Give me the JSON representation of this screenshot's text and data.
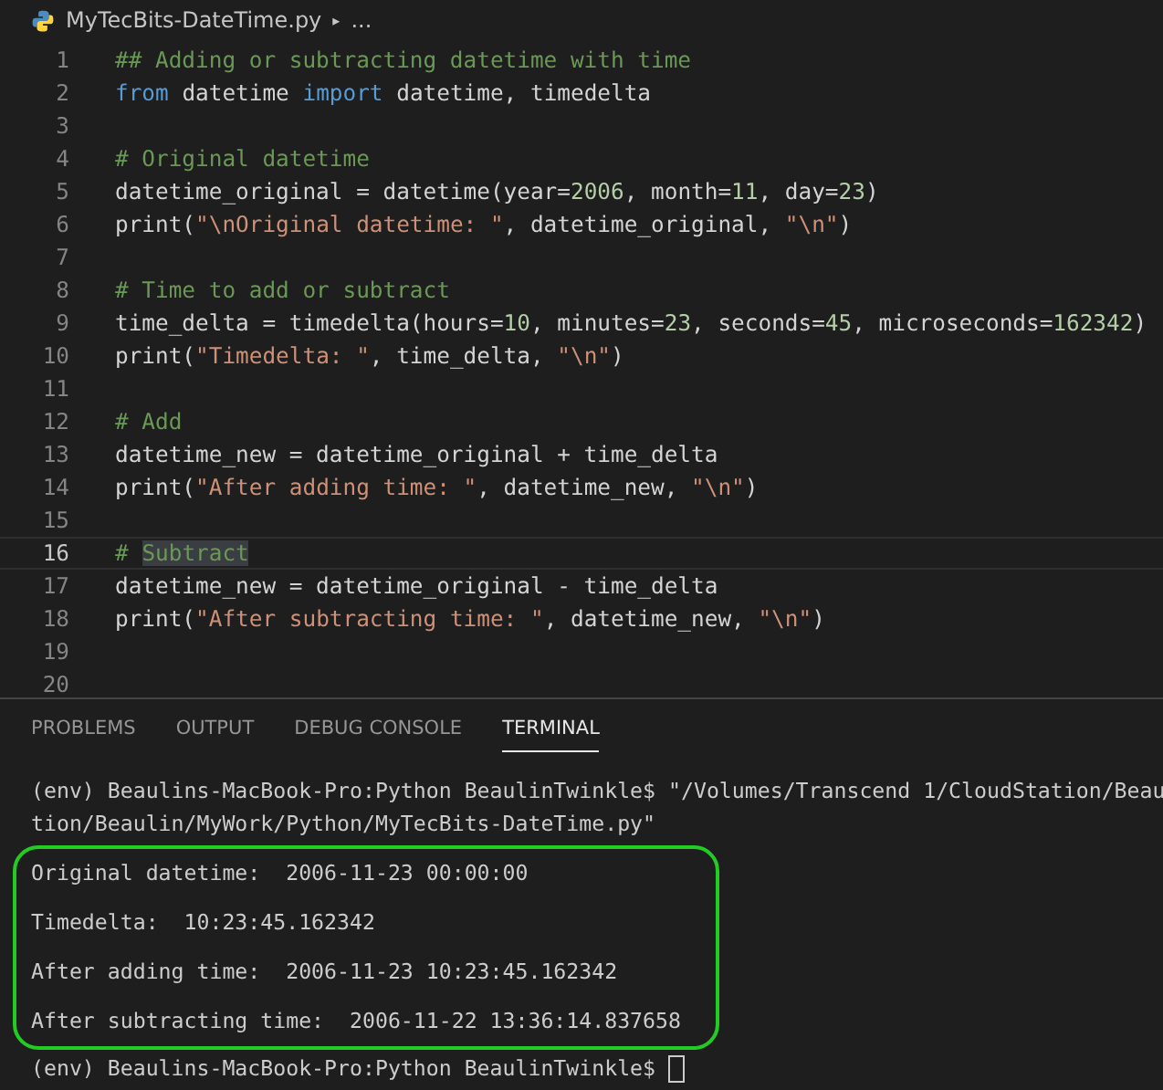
{
  "breadcrumb": {
    "file": "MyTecBits-DateTime.py",
    "separator": "▸",
    "more": "..."
  },
  "code_lines": [
    {
      "number": "1",
      "current": false,
      "tokens": [
        {
          "kind": "comment",
          "text": "## Adding or subtracting datetime with time"
        }
      ]
    },
    {
      "number": "2",
      "current": false,
      "tokens": [
        {
          "kind": "keyword",
          "text": "from"
        },
        {
          "kind": "plain",
          "text": " datetime "
        },
        {
          "kind": "keyword",
          "text": "import"
        },
        {
          "kind": "plain",
          "text": " datetime, timedelta"
        }
      ]
    },
    {
      "number": "3",
      "current": false
    },
    {
      "number": "4",
      "current": false,
      "tokens": [
        {
          "kind": "comment",
          "text": "# Original datetime"
        }
      ]
    },
    {
      "number": "5",
      "current": false,
      "tokens": [
        {
          "kind": "plain",
          "text": "datetime_original = datetime(year="
        },
        {
          "kind": "number",
          "text": "2006"
        },
        {
          "kind": "plain",
          "text": ", month="
        },
        {
          "kind": "number",
          "text": "11"
        },
        {
          "kind": "plain",
          "text": ", day="
        },
        {
          "kind": "number",
          "text": "23"
        },
        {
          "kind": "plain",
          "text": ")"
        }
      ]
    },
    {
      "number": "6",
      "current": false,
      "tokens": [
        {
          "kind": "plain",
          "text": "print("
        },
        {
          "kind": "string",
          "text": "\"\\nOriginal datetime: \""
        },
        {
          "kind": "plain",
          "text": ", datetime_original, "
        },
        {
          "kind": "string",
          "text": "\"\\n\""
        },
        {
          "kind": "plain",
          "text": ")"
        }
      ]
    },
    {
      "number": "7",
      "current": false
    },
    {
      "number": "8",
      "current": false,
      "tokens": [
        {
          "kind": "comment",
          "text": "# Time to add or subtract"
        }
      ]
    },
    {
      "number": "9",
      "current": false,
      "tokens": [
        {
          "kind": "plain",
          "text": "time_delta = timedelta(hours="
        },
        {
          "kind": "number",
          "text": "10"
        },
        {
          "kind": "plain",
          "text": ", minutes="
        },
        {
          "kind": "number",
          "text": "23"
        },
        {
          "kind": "plain",
          "text": ", seconds="
        },
        {
          "kind": "number",
          "text": "45"
        },
        {
          "kind": "plain",
          "text": ", microseconds="
        },
        {
          "kind": "number",
          "text": "162342"
        },
        {
          "kind": "plain",
          "text": ")"
        }
      ]
    },
    {
      "number": "10",
      "current": false,
      "tokens": [
        {
          "kind": "plain",
          "text": "print("
        },
        {
          "kind": "string",
          "text": "\"Timedelta: \""
        },
        {
          "kind": "plain",
          "text": ", time_delta, "
        },
        {
          "kind": "string",
          "text": "\"\\n\""
        },
        {
          "kind": "plain",
          "text": ")"
        }
      ]
    },
    {
      "number": "11",
      "current": false
    },
    {
      "number": "12",
      "current": false,
      "tokens": [
        {
          "kind": "comment",
          "text": "# Add"
        }
      ]
    },
    {
      "number": "13",
      "current": false,
      "tokens": [
        {
          "kind": "plain",
          "text": "datetime_new = datetime_original + time_delta"
        }
      ]
    },
    {
      "number": "14",
      "current": false,
      "tokens": [
        {
          "kind": "plain",
          "text": "print("
        },
        {
          "kind": "string",
          "text": "\"After adding time: \""
        },
        {
          "kind": "plain",
          "text": ", datetime_new, "
        },
        {
          "kind": "string",
          "text": "\"\\n\""
        },
        {
          "kind": "plain",
          "text": ")"
        }
      ]
    },
    {
      "number": "15",
      "current": false
    },
    {
      "number": "16",
      "current": true,
      "tokens": [
        {
          "kind": "comment",
          "text": "# "
        },
        {
          "kind": "match",
          "text": "Subtract"
        }
      ]
    },
    {
      "number": "17",
      "current": false,
      "tokens": [
        {
          "kind": "plain",
          "text": "datetime_new = datetime_original - time_delta"
        }
      ]
    },
    {
      "number": "18",
      "current": false,
      "tokens": [
        {
          "kind": "plain",
          "text": "print("
        },
        {
          "kind": "string",
          "text": "\"After subtracting time: \""
        },
        {
          "kind": "plain",
          "text": ", datetime_new, "
        },
        {
          "kind": "string",
          "text": "\"\\n\""
        },
        {
          "kind": "plain",
          "text": ")"
        }
      ]
    },
    {
      "number": "19",
      "current": false
    },
    {
      "number": "20",
      "current": false
    }
  ],
  "panel_tabs": [
    {
      "label": "PROBLEMS",
      "selected": false
    },
    {
      "label": "OUTPUT",
      "selected": false
    },
    {
      "label": "DEBUG CONSOLE",
      "selected": false
    },
    {
      "label": "TERMINAL",
      "selected": true
    }
  ],
  "terminal": {
    "command_lines": [
      "(env) Beaulins-MacBook-Pro:Python BeaulinTwinkle$ \"/Volumes/Transcend 1/CloudStation/Beau",
      "tion/Beaulin/MyWork/Python/MyTecBits-DateTime.py\""
    ],
    "output_lines": [
      "Original datetime:  2006-11-23 00:00:00",
      "Timedelta:  10:23:45.162342",
      "After adding time:  2006-11-23 10:23:45.162342",
      "After subtracting time:  2006-11-22 13:36:14.837658"
    ],
    "prompt": "(env) Beaulins-MacBook-Pro:Python BeaulinTwinkle$"
  }
}
